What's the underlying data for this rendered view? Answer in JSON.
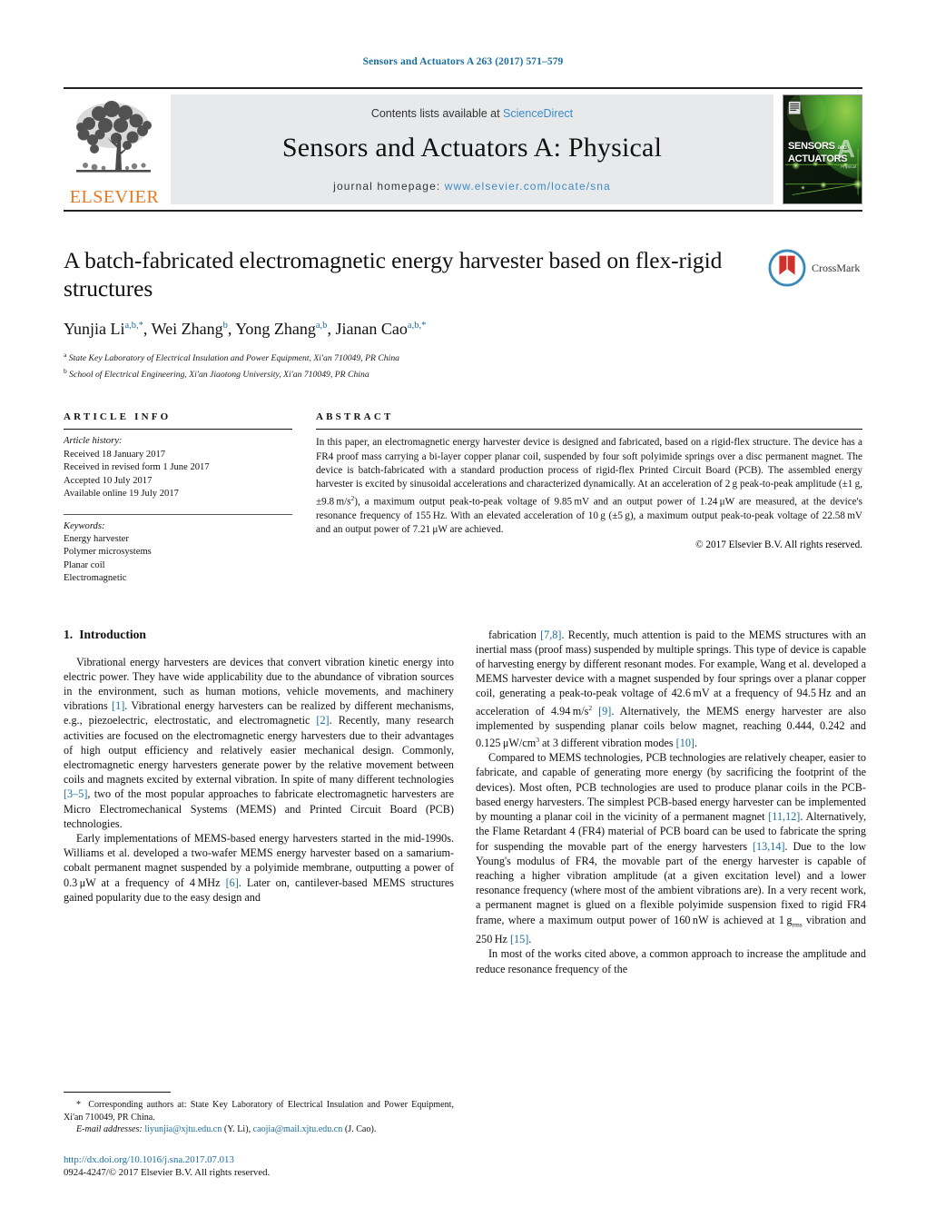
{
  "running_head": "Sensors and Actuators A 263 (2017) 571–579",
  "masthead": {
    "elsevier_wordmark": "ELSEVIER",
    "contents_prefix": "Contents lists available at ",
    "contents_link": "ScienceDirect",
    "journal_title": "Sensors and Actuators A: Physical",
    "homepage_prefix": "journal homepage: ",
    "homepage_url": "www.elsevier.com/locate/sna",
    "cover_line1": "SENSORS",
    "cover_and": "and",
    "cover_line2": "ACTUATORS",
    "cover_letter": "A",
    "cover_subtext": "Physical"
  },
  "article": {
    "title": "A batch-fabricated electromagnetic energy harvester based on flex-rigid structures",
    "authors_html": "Yunjia Li<sup>a,b,*</sup>, Wei Zhang<sup>b</sup>, Yong Zhang<sup>a,b</sup>, Jianan Cao<sup>a,b,*</sup>",
    "affiliations": [
      {
        "marker": "a",
        "text": "State Key Laboratory of Electrical Insulation and Power Equipment, Xi'an 710049, PR China"
      },
      {
        "marker": "b",
        "text": "School of Electrical Engineering, Xi'an Jiaotong University, Xi'an 710049, PR China"
      }
    ],
    "crossmark_label": "CrossMark"
  },
  "article_info": {
    "heading": "ARTICLE INFO",
    "history_label": "Article history:",
    "history": [
      "Received 18 January 2017",
      "Received in revised form 1 June 2017",
      "Accepted 10 July 2017",
      "Available online 19 July 2017"
    ],
    "keywords_label": "Keywords:",
    "keywords": [
      "Energy harvester",
      "Polymer microsystems",
      "Planar coil",
      "Electromagnetic"
    ]
  },
  "abstract": {
    "heading": "ABSTRACT",
    "text_html": "In this paper, an electromagnetic energy harvester device is designed and fabricated, based on a rigid-flex structure. The device has a FR4 proof mass carrying a bi-layer copper planar coil, suspended by four soft polyimide springs over a disc permanent magnet. The device is batch-fabricated with a standard production process of rigid-flex Printed Circuit Board (PCB). The assembled energy harvester is excited by sinusoidal accelerations and characterized dynamically. At an acceleration of 2&thinsp;g peak-to-peak amplitude (&plusmn;1&thinsp;g, &plusmn;9.8&thinsp;m/s<sup class=\"sm\">2</sup>), a maximum output peak-to-peak voltage of 9.85&thinsp;mV and an output power of 1.24&thinsp;&mu;W are measured, at the device's resonance frequency of 155&thinsp;Hz. With an elevated acceleration of 10&thinsp;g (&plusmn;5&thinsp;g), a maximum output peak-to-peak voltage of 22.58&thinsp;mV and an output power of 7.21&thinsp;&mu;W are achieved.",
    "copyright": "© 2017 Elsevier B.V. All rights reserved."
  },
  "section": {
    "number": "1.",
    "title": "Introduction"
  },
  "body": {
    "left_paragraphs_html": [
      "Vibrational energy harvesters are devices that convert vibration kinetic energy into electric power. They have wide applicability due to the abundance of vibration sources in the environment, such as human motions, vehicle movements, and machinery vibrations <span class=\"ref\">[1]</span>. Vibrational energy harvesters can be realized by different mechanisms, e.g., piezoelectric, electrostatic, and electromagnetic <span class=\"ref\">[2]</span>. Recently, many research activities are focused on the electromagnetic energy harvesters due to their advantages of high output efficiency and relatively easier mechanical design. Commonly, electromagnetic energy harvesters generate power by the relative movement between coils and magnets excited by external vibration. In spite of many different technologies <span class=\"ref\">[3–5]</span>, two of the most popular approaches to fabricate electromagnetic harvesters are Micro Electromechanical Systems (MEMS) and Printed Circuit Board (PCB) technologies.",
      "Early implementations of MEMS-based energy harvesters started in the mid-1990s. Williams et al. developed a two-wafer MEMS energy harvester based on a samarium-cobalt permanent magnet suspended by a polyimide membrane, outputting a power of 0.3&thinsp;&mu;W at a frequency of 4&thinsp;MHz <span class=\"ref\">[6]</span>. Later on, cantilever-based MEMS structures gained popularity due to the easy design and"
    ],
    "right_paragraphs_html": [
      "fabrication <span class=\"ref\">[7,8]</span>. Recently, much attention is paid to the MEMS structures with an inertial mass (proof mass) suspended by multiple springs. This type of device is capable of harvesting energy by different resonant modes. For example, Wang et al. developed a MEMS harvester device with a magnet suspended by four springs over a planar copper coil, generating a peak-to-peak voltage of 42.6&thinsp;mV at a frequency of 94.5&thinsp;Hz and an acceleration of 4.94&thinsp;m/s<sup class=\"sm\">2</sup> <span class=\"ref\">[9]</span>. Alternatively, the MEMS energy harvester are also implemented by suspending planar coils below magnet, reaching 0.444, 0.242 and 0.125&thinsp;&mu;W/cm<sup class=\"sm\">3</sup> at 3 different vibration modes <span class=\"ref\">[10]</span>.",
      "Compared to MEMS technologies, PCB technologies are relatively cheaper, easier to fabricate, and capable of generating more energy (by sacrificing the footprint of the devices). Most often, PCB technologies are used to produce planar coils in the PCB-based energy harvesters. The simplest PCB-based energy harvester can be implemented by mounting a planar coil in the vicinity of a permanent magnet <span class=\"ref\">[11,12]</span>. Alternatively, the Flame Retardant 4 (FR4) material of PCB board can be used to fabricate the spring for suspending the movable part of the energy harvesters <span class=\"ref\">[13,14]</span>. Due to the low Young's modulus of FR4, the movable part of the energy harvester is capable of reaching a higher vibration amplitude (at a given excitation level) and a lower resonance frequency (where most of the ambient vibrations are). In a very recent work, a permanent magnet is glued on a flexible polyimide suspension fixed to rigid FR4 frame, where a maximum output power of 160&thinsp;nW is achieved at 1&thinsp;g<sub class=\"sm\">rms</sub> vibration and 250&thinsp;Hz <span class=\"ref\">[15]</span>.",
      "In most of the works cited above, a common approach to increase the amplitude and reduce resonance frequency of the"
    ]
  },
  "footnotes": {
    "corresponding_html": "<span class=\"star\">*</span> Corresponding authors at: State Key Laboratory of Electrical Insulation and Power Equipment, Xi'an 710049, PR China.",
    "email_label": "E-mail addresses:",
    "emails_html": "<span class=\"link\">liyunjia@xjtu.edu.cn</span> (Y. Li), <span class=\"link\">caojia@mail.xjtu.edu.cn</span> (J. Cao)."
  },
  "footer": {
    "doi": "http://dx.doi.org/10.1016/j.sna.2017.07.013",
    "issn_line": "0924-4247/© 2017 Elsevier B.V. All rights reserved."
  },
  "colors": {
    "link_blue": "#1a6d9e",
    "sciencedirect_blue": "#3a8cc8",
    "elsevier_orange": "#E87722",
    "band_grey": "#e8e9ea",
    "cover_green": "#4aa832"
  }
}
